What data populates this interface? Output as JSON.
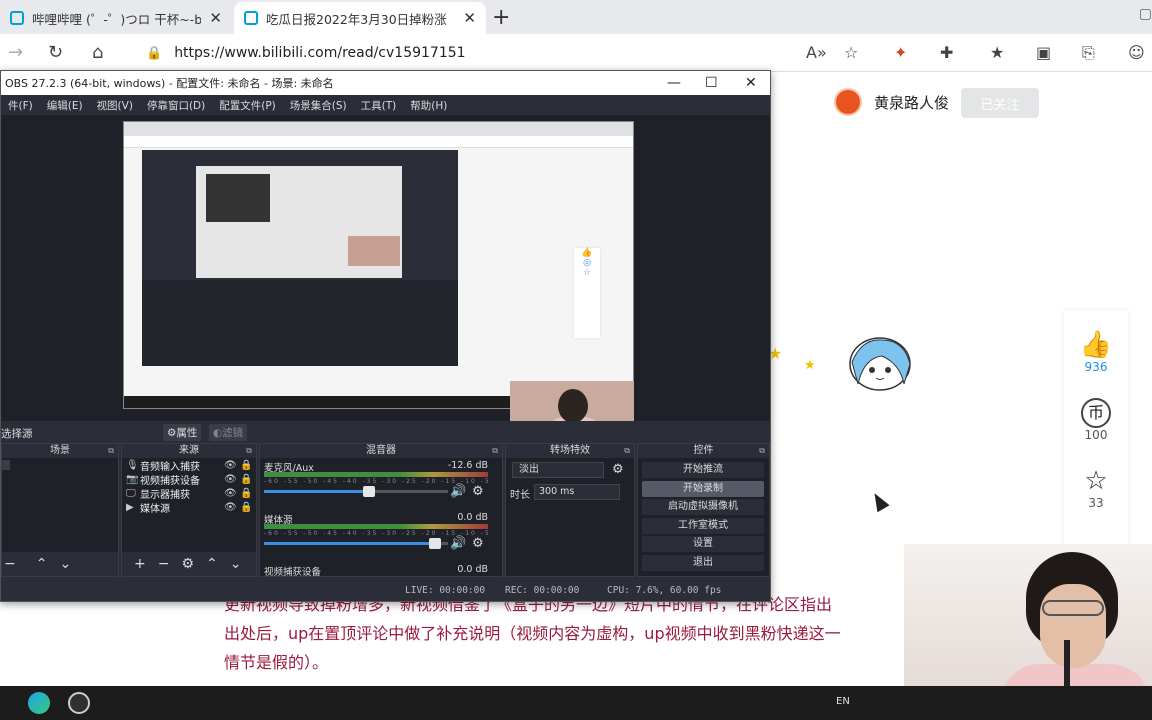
{
  "browser": {
    "tabs": [
      {
        "title": "哔哩哔哩 (゜-゜)つロ 干杯~-bilil",
        "active": false
      },
      {
        "title": "吃瓜日报2022年3月30日掉粉涨",
        "active": true
      }
    ],
    "url": "https://www.bilibili.com/read/cv15917151"
  },
  "page": {
    "author_name": "黄泉路人俊",
    "follow_label": "已关注",
    "rail": [
      {
        "icon": "like-icon",
        "glyph": "👍",
        "count": "936"
      },
      {
        "icon": "coin-icon",
        "glyph": "币",
        "count": "100"
      },
      {
        "icon": "star-icon",
        "glyph": "☆",
        "count": "33"
      }
    ],
    "article_lines": [
      "更新视频导致掉粉增多，新视频借鉴了《盒子的另一边》短片中的情节，在评论区指出",
      "出处后，up在置顶评论中做了补充说明（视频内容为虚构，up视频中收到黑粉快递这一",
      "情节是假的）。"
    ]
  },
  "obs": {
    "title": "OBS 27.2.3 (64-bit, windows) - 配置文件: 未命名 - 场景: 未命名",
    "menu": [
      "件(F)",
      "编辑(E)",
      "视图(V)",
      "停靠窗口(D)",
      "配置文件(P)",
      "场景集合(S)",
      "工具(T)",
      "帮助(H)"
    ],
    "source_label": "选择源",
    "properties_label": "属性",
    "filters_label": "滤镜",
    "docks": {
      "scenes": "场景",
      "sources": "来源",
      "mixer": "混音器",
      "transitions": "转场特效",
      "controls": "控件"
    },
    "sources": [
      {
        "icon": "mic-icon",
        "glyph": "🎙",
        "name": "音频输入捕获"
      },
      {
        "icon": "camera-icon",
        "glyph": "📷",
        "name": "视频捕获设备"
      },
      {
        "icon": "monitor-icon",
        "glyph": "🖵",
        "name": "显示器捕获"
      },
      {
        "icon": "play-icon",
        "glyph": "▶",
        "name": "媒体源"
      }
    ],
    "mixer": [
      {
        "name": "麦克风/Aux",
        "db": "-12.6 dB",
        "volume": 0.57
      },
      {
        "name": "媒体源",
        "db": "0.0 dB",
        "volume": 0.93
      },
      {
        "name": "视频捕获设备",
        "db": "0.0 dB",
        "volume": 0.93
      }
    ],
    "mixer_ticks": "-60 -55 -50 -45 -40 -35 -30 -25 -20 -15 -10 -5 0",
    "transition": {
      "value": "淡出",
      "duration_label": "时长",
      "duration": "300 ms"
    },
    "controls": [
      {
        "label": "开始推流",
        "active": false
      },
      {
        "label": "开始录制",
        "active": true
      },
      {
        "label": "启动虚拟摄像机",
        "active": false
      },
      {
        "label": "工作室模式",
        "active": false
      },
      {
        "label": "设置",
        "active": false
      },
      {
        "label": "退出",
        "active": false
      }
    ],
    "status": {
      "live": "LIVE: 00:00:00",
      "rec": "REC: 00:00:00",
      "cpu": "CPU: 7.6%, 60.00 fps"
    }
  },
  "taskbar": {
    "lang": "EN"
  }
}
